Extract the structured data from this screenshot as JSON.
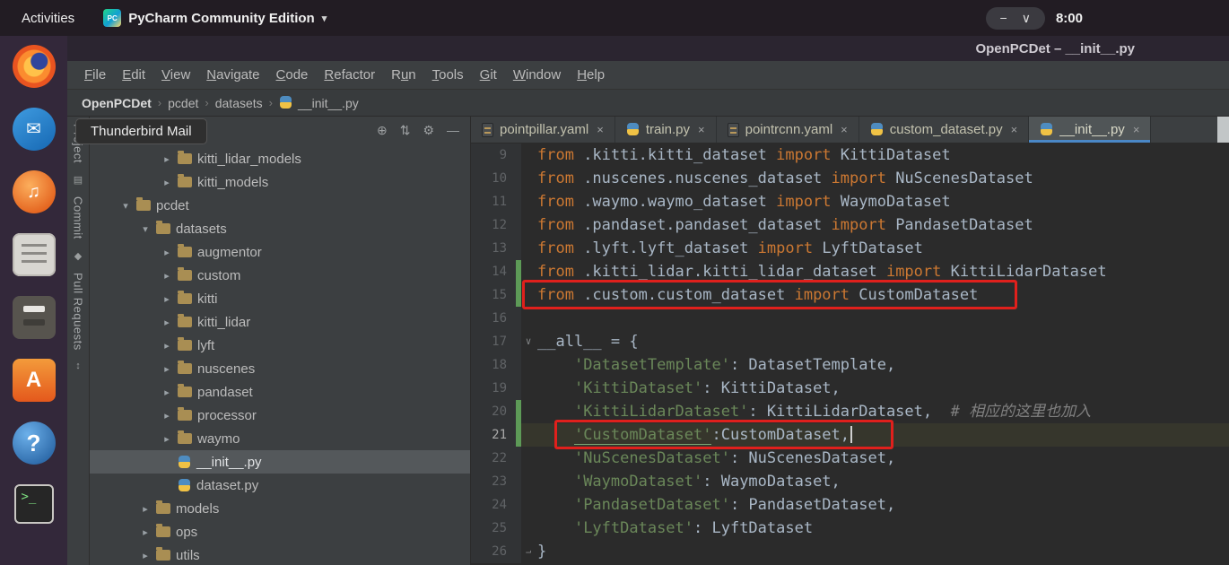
{
  "top_bar": {
    "activities": "Activities",
    "app_icon_label": "PC",
    "app_title": "PyCharm Community Edition",
    "caret_glyph": "▾",
    "window_controls": [
      {
        "name": "minimize-icon",
        "glyph": "−"
      },
      {
        "name": "chevron-down-icon",
        "glyph": "∨"
      }
    ],
    "clock": "8:00"
  },
  "window_title": "OpenPCDet – __init__.py",
  "menu_items": [
    {
      "label": "File",
      "u": 0
    },
    {
      "label": "Edit",
      "u": 0
    },
    {
      "label": "View",
      "u": 0
    },
    {
      "label": "Navigate",
      "u": 0
    },
    {
      "label": "Code",
      "u": 0
    },
    {
      "label": "Refactor",
      "u": 0
    },
    {
      "label": "Run",
      "u": 1
    },
    {
      "label": "Tools",
      "u": 0
    },
    {
      "label": "Git",
      "u": 0
    },
    {
      "label": "Window",
      "u": 0
    },
    {
      "label": "Help",
      "u": 0
    }
  ],
  "breadcrumb": [
    {
      "label": "OpenPCDet",
      "bold": true
    },
    {
      "label": "pcdet"
    },
    {
      "label": "datasets"
    },
    {
      "label": "__init__.py",
      "icon": "python"
    }
  ],
  "tooltip": {
    "text": "Thunderbird Mail"
  },
  "dock": [
    {
      "name": "firefox",
      "glyph": ""
    },
    {
      "name": "thunderbird",
      "glyph": "✉"
    },
    {
      "name": "rhythmbox",
      "glyph": "♫"
    },
    {
      "name": "text-editor",
      "glyph": ""
    },
    {
      "name": "files",
      "glyph": ""
    },
    {
      "name": "ubuntu-software",
      "glyph": "A"
    },
    {
      "name": "help",
      "glyph": "?"
    },
    {
      "name": "terminal",
      "glyph": ">_"
    }
  ],
  "tool_stripe": [
    {
      "label": "Project",
      "icon": "project-folder",
      "icon_glyph": "▤"
    },
    {
      "label": "Commit",
      "icon": "commit",
      "icon_glyph": "◆"
    },
    {
      "label": "Pull Requests",
      "icon": "pull-requests",
      "icon_glyph": "↕"
    }
  ],
  "project_panel": {
    "header_icons": [
      {
        "name": "locate-file-icon",
        "glyph": "⊕"
      },
      {
        "name": "collapse-all-icon",
        "glyph": "⇅"
      },
      {
        "name": "settings-gear-icon",
        "glyph": "⚙"
      },
      {
        "name": "hide-panel-icon",
        "glyph": "—"
      }
    ],
    "tree": [
      {
        "label": "kitti_lidar_models",
        "type": "folder",
        "state": "collapsed",
        "depth": 2
      },
      {
        "label": "kitti_models",
        "type": "folder",
        "state": "collapsed",
        "depth": 2
      },
      {
        "label": "pcdet",
        "type": "folder",
        "state": "expanded",
        "depth": 0
      },
      {
        "label": "datasets",
        "type": "folder",
        "state": "expanded",
        "depth": 1
      },
      {
        "label": "augmentor",
        "type": "folder",
        "state": "collapsed",
        "depth": 2
      },
      {
        "label": "custom",
        "type": "folder",
        "state": "collapsed",
        "depth": 2
      },
      {
        "label": "kitti",
        "type": "folder",
        "state": "collapsed",
        "depth": 2
      },
      {
        "label": "kitti_lidar",
        "type": "folder",
        "state": "collapsed",
        "depth": 2
      },
      {
        "label": "lyft",
        "type": "folder",
        "state": "collapsed",
        "depth": 2
      },
      {
        "label": "nuscenes",
        "type": "folder",
        "state": "collapsed",
        "depth": 2
      },
      {
        "label": "pandaset",
        "type": "folder",
        "state": "collapsed",
        "depth": 2
      },
      {
        "label": "processor",
        "type": "folder",
        "state": "collapsed",
        "depth": 2
      },
      {
        "label": "waymo",
        "type": "folder",
        "state": "collapsed",
        "depth": 2
      },
      {
        "label": "__init__.py",
        "type": "python-file",
        "depth": 2,
        "selected": true
      },
      {
        "label": "dataset.py",
        "type": "python-file",
        "depth": 2
      },
      {
        "label": "models",
        "type": "folder",
        "state": "collapsed",
        "depth": 1
      },
      {
        "label": "ops",
        "type": "folder",
        "state": "collapsed",
        "depth": 1
      },
      {
        "label": "utils",
        "type": "folder",
        "state": "collapsed",
        "depth": 1
      }
    ]
  },
  "editor_tabs": [
    {
      "label": "pointpillar.yaml",
      "icon": "yaml"
    },
    {
      "label": "train.py",
      "icon": "python"
    },
    {
      "label": "pointrcnn.yaml",
      "icon": "yaml"
    },
    {
      "label": "custom_dataset.py",
      "icon": "python"
    },
    {
      "label": "__init__.py",
      "icon": "python",
      "active": true
    }
  ],
  "editor": {
    "change_marker_lines": [
      14,
      15,
      20,
      21
    ],
    "fold_markers": {
      "17": "start",
      "26": "end"
    },
    "lines": [
      {
        "n": 9,
        "segs": [
          [
            "kw",
            "from"
          ],
          [
            "pl",
            " .kitti.kitti_dataset "
          ],
          [
            "kw",
            "import"
          ],
          [
            "pl",
            " KittiDataset"
          ]
        ]
      },
      {
        "n": 10,
        "segs": [
          [
            "kw",
            "from"
          ],
          [
            "pl",
            " .nuscenes.nuscenes_dataset "
          ],
          [
            "kw",
            "import"
          ],
          [
            "pl",
            " NuScenesDataset"
          ]
        ]
      },
      {
        "n": 11,
        "segs": [
          [
            "kw",
            "from"
          ],
          [
            "pl",
            " .waymo.waymo_dataset "
          ],
          [
            "kw",
            "import"
          ],
          [
            "pl",
            " WaymoDataset"
          ]
        ]
      },
      {
        "n": 12,
        "segs": [
          [
            "kw",
            "from"
          ],
          [
            "pl",
            " .pandaset.pandaset_dataset "
          ],
          [
            "kw",
            "import"
          ],
          [
            "pl",
            " PandasetDataset"
          ]
        ]
      },
      {
        "n": 13,
        "segs": [
          [
            "kw",
            "from"
          ],
          [
            "pl",
            " .lyft.lyft_dataset "
          ],
          [
            "kw",
            "import"
          ],
          [
            "pl",
            " LyftDataset"
          ]
        ]
      },
      {
        "n": 14,
        "segs": [
          [
            "kw",
            "from"
          ],
          [
            "pl",
            " .kitti_lidar.kitti_lidar_dataset "
          ],
          [
            "kw",
            "import"
          ],
          [
            "pl",
            " KittiLidarDataset"
          ]
        ]
      },
      {
        "n": 15,
        "segs": [
          [
            "kw",
            "from"
          ],
          [
            "pl",
            " .custom.custom_dataset "
          ],
          [
            "kw",
            "import"
          ],
          [
            "pl",
            " CustomDataset"
          ]
        ]
      },
      {
        "n": 16,
        "segs": []
      },
      {
        "n": 17,
        "segs": [
          [
            "pl",
            "__all__ = {"
          ]
        ]
      },
      {
        "n": 18,
        "segs": [
          [
            "pl",
            "    "
          ],
          [
            "str",
            "'DatasetTemplate'"
          ],
          [
            "pl",
            ": DatasetTemplate,"
          ]
        ]
      },
      {
        "n": 19,
        "segs": [
          [
            "pl",
            "    "
          ],
          [
            "str",
            "'KittiDataset'"
          ],
          [
            "pl",
            ": KittiDataset,"
          ]
        ]
      },
      {
        "n": 20,
        "segs": [
          [
            "pl",
            "    "
          ],
          [
            "stru",
            "'KittiLidarDataset'"
          ],
          [
            "pl",
            ": KittiLidarDataset,  "
          ],
          [
            "com",
            "# 相应的这里也加入"
          ]
        ]
      },
      {
        "n": 21,
        "caret": true,
        "highlight": true,
        "segs": [
          [
            "pl",
            "    "
          ],
          [
            "stru",
            "'CustomDataset'"
          ],
          [
            "pl",
            ":CustomDataset,"
          ]
        ]
      },
      {
        "n": 22,
        "segs": [
          [
            "pl",
            "    "
          ],
          [
            "str",
            "'NuScenesDataset'"
          ],
          [
            "pl",
            ": NuScenesDataset,"
          ]
        ]
      },
      {
        "n": 23,
        "segs": [
          [
            "pl",
            "    "
          ],
          [
            "str",
            "'WaymoDataset'"
          ],
          [
            "pl",
            ": WaymoDataset,"
          ]
        ]
      },
      {
        "n": 24,
        "segs": [
          [
            "pl",
            "    "
          ],
          [
            "str",
            "'PandasetDataset'"
          ],
          [
            "pl",
            ": PandasetDataset,"
          ]
        ]
      },
      {
        "n": 25,
        "segs": [
          [
            "pl",
            "    "
          ],
          [
            "str",
            "'LyftDataset'"
          ],
          [
            "pl",
            ": LyftDataset"
          ]
        ]
      },
      {
        "n": 26,
        "segs": [
          [
            "pl",
            "}"
          ]
        ]
      }
    ]
  },
  "annotations": [
    {
      "name": "red-box-line-15",
      "target_line": 15
    },
    {
      "name": "red-box-line-21",
      "target_line": 21
    }
  ],
  "ui": {
    "crumb_separator": "›",
    "chevron_expanded": "▾",
    "chevron_collapsed": "▸",
    "close_glyph": "×",
    "fold_start_glyph": "∨",
    "fold_end_glyph": "⌐"
  },
  "colors": {
    "keyword": "#cc7832",
    "plain_text": "#a9b7c6",
    "string": "#6a8759",
    "comment": "#808080",
    "annotation_red": "#e0201c",
    "active_tab_underline": "#4a88c7",
    "change_marker_green": "#5d9a57",
    "editor_background": "#2b2b2b",
    "panel_background": "#3c3f41"
  }
}
